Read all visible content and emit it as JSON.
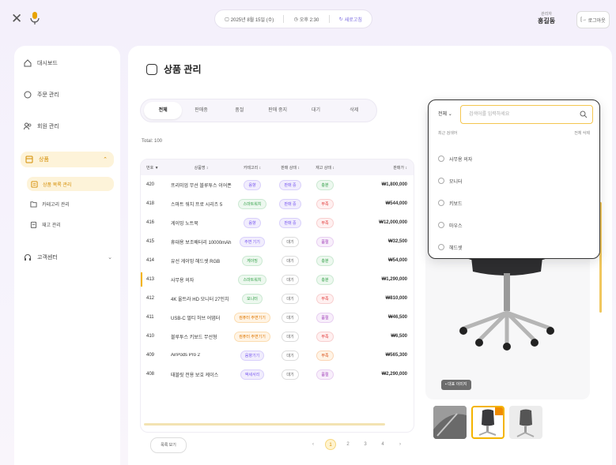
{
  "topbar": {
    "close_icon": "close-icon",
    "center": [
      {
        "label": "2025년 8월 15일 (수)",
        "accent": false
      },
      {
        "label": "오후 2:30",
        "accent": false
      },
      {
        "label": "새로고침",
        "accent": true
      }
    ],
    "user_subtitle": "관리자",
    "user_name": "홍길동",
    "logout_label": "로그아웃"
  },
  "sidebar": {
    "items": [
      {
        "label": "대시보드"
      },
      {
        "label": "주문 관리"
      },
      {
        "label": "회원 관리"
      }
    ],
    "group": {
      "label": "상품"
    },
    "sub_items": [
      {
        "label": "상품 목록 관리"
      },
      {
        "label": "카테고리 관리"
      },
      {
        "label": "재고 관리"
      }
    ],
    "settings": {
      "label": "고객센터"
    }
  },
  "main": {
    "title": "상품 관리",
    "tabs": [
      "전체",
      "판매중",
      "품절",
      "판매 중지",
      "대기",
      "삭제"
    ],
    "active_tab": 0,
    "total": "Total: 100",
    "columns": [
      "번호 ▼",
      "상품명 ↕",
      "카테고리 ↕",
      "판매 상태 ↕",
      "재고 상태 ↕",
      "판매가 ↕"
    ],
    "rows": [
      {
        "no": "420",
        "name": "프리미엄 무선 블루투스 이어폰",
        "cat": "음향",
        "cat_color": "purple",
        "sale": "판매 중",
        "sale_color": "purple",
        "stock": "충분",
        "stock_color": "green",
        "price": "₩1,800,000"
      },
      {
        "no": "418",
        "name": "스마트 워치 프로 시리즈 5",
        "cat": "스마트워치",
        "cat_color": "green",
        "sale": "판매 중",
        "sale_color": "purple",
        "stock": "부족",
        "stock_color": "red",
        "price": "₩544,000"
      },
      {
        "no": "416",
        "name": "게이밍 노트북",
        "cat": "음향",
        "cat_color": "purple",
        "sale": "판매 중",
        "sale_color": "purple",
        "stock": "부족",
        "stock_color": "red",
        "price": "₩12,000,000"
      },
      {
        "no": "415",
        "name": "휴대용 보조배터리 10000mAh",
        "cat": "주변 기기",
        "cat_color": "purple",
        "sale": "대기",
        "sale_color": "grey",
        "stock": "품절",
        "stock_color": "violet",
        "price": "₩32,500"
      },
      {
        "no": "414",
        "name": "유선 게이밍 헤드셋 RGB",
        "cat": "게이밍",
        "cat_color": "green",
        "sale": "대기",
        "sale_color": "grey",
        "stock": "충분",
        "stock_color": "green",
        "price": "₩54,000"
      },
      {
        "no": "413",
        "name": "사무용 의자",
        "cat": "스마트워치",
        "cat_color": "green",
        "sale": "대기",
        "sale_color": "grey",
        "stock": "충분",
        "stock_color": "green",
        "price": "₩1,290,000",
        "selected": true
      },
      {
        "no": "412",
        "name": "4K 울트라 HD 모니터 27인치",
        "cat": "모니터",
        "cat_color": "green",
        "sale": "대기",
        "sale_color": "grey",
        "stock": "부족",
        "stock_color": "red",
        "price": "₩810,000"
      },
      {
        "no": "411",
        "name": "USB-C 멀티 허브 어댑터",
        "cat": "컴퓨터 주변기기",
        "cat_color": "orange",
        "sale": "대기",
        "sale_color": "grey",
        "stock": "품절",
        "stock_color": "violet",
        "price": "₩46,500"
      },
      {
        "no": "410",
        "name": "블루투스 키보드 무선형",
        "cat": "컴퓨터 주변기기",
        "cat_color": "orange",
        "sale": "대기",
        "sale_color": "grey",
        "stock": "부족",
        "stock_color": "red",
        "price": "₩6,500"
      },
      {
        "no": "409",
        "name": "AirPods Pro 2",
        "cat": "음향기기",
        "cat_color": "purple",
        "sale": "대기",
        "sale_color": "grey",
        "stock": "부족",
        "stock_color": "amber",
        "price": "₩565,300"
      },
      {
        "no": "408",
        "name": "태블릿 전용 보호 케이스",
        "cat": "액세서리",
        "cat_color": "purple",
        "sale": "대기",
        "sale_color": "grey",
        "stock": "품절",
        "stock_color": "violet",
        "price": "₩2,290,000"
      }
    ],
    "footer_button": "목록 보기",
    "pages": [
      "‹",
      "1",
      "2",
      "3",
      "4",
      "›"
    ],
    "active_page": 1
  },
  "detail": {
    "image_badge": "대표 이미지"
  },
  "search": {
    "select_label": "전체 ⌄",
    "placeholder": "검색어를 입력하세요",
    "recent_label": "최근 검색어",
    "clear_label": "전체 삭제",
    "recent": [
      "사무용 의자",
      "모니터",
      "키보드",
      "마우스",
      "헤드셋"
    ]
  },
  "colors": {
    "accent": "#f4b400",
    "sidebar_active_bg": "#fdf3d9",
    "sidebar_active_text": "#d48c00"
  }
}
